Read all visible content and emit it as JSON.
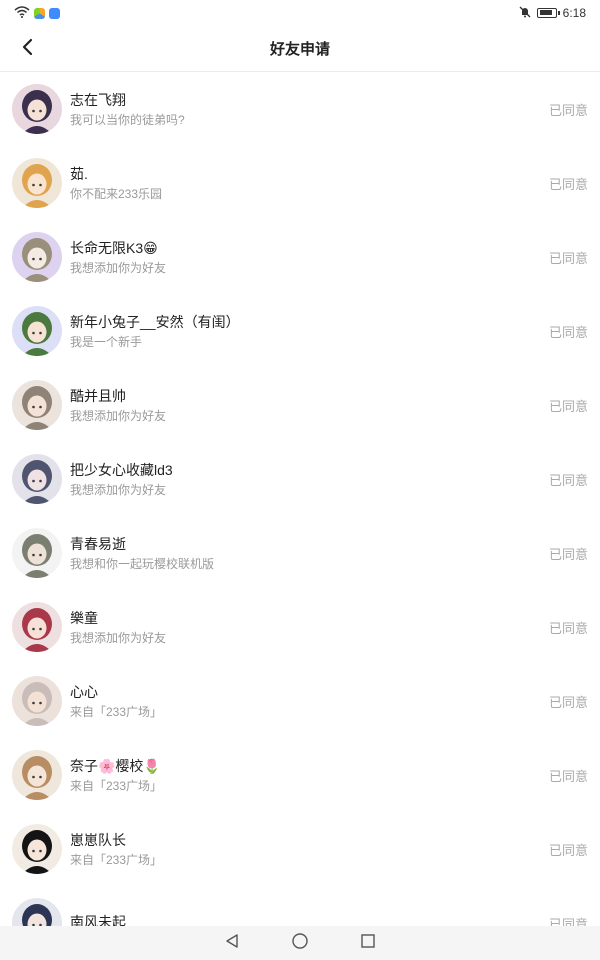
{
  "status_bar": {
    "time": "6:18"
  },
  "header": {
    "title": "好友申请"
  },
  "requests": [
    {
      "name": "志在飞翔",
      "message": "我可以当你的徒弟吗?",
      "status": "已同意",
      "avatar_colors": [
        "#e9d7df",
        "#3a2f4d",
        "#f6e1d6"
      ]
    },
    {
      "name": "茹.",
      "message": "你不配来233乐园",
      "status": "已同意",
      "avatar_colors": [
        "#efe6d8",
        "#e0a44e",
        "#f9e4cf"
      ]
    },
    {
      "name": "长命无限K3😁",
      "message": "我想添加你为好友",
      "status": "已同意",
      "avatar_colors": [
        "#ddd3f0",
        "#9a8f7a",
        "#f3ece2"
      ]
    },
    {
      "name": "新年小兔子__安然（有闺）",
      "message": "我是一个新手",
      "status": "已同意",
      "avatar_colors": [
        "#dcdff5",
        "#4a7a3e",
        "#f6e3d3"
      ]
    },
    {
      "name": "酷并且帅",
      "message": "我想添加你为好友",
      "status": "已同意",
      "avatar_colors": [
        "#ece3dc",
        "#8f8378",
        "#f4e2d6"
      ]
    },
    {
      "name": "把少女心收藏ld3",
      "message": "我想添加你为好友",
      "status": "已同意",
      "avatar_colors": [
        "#e3e2ea",
        "#4f556e",
        "#efe1e4"
      ]
    },
    {
      "name": "青春易逝",
      "message": "我想和你一起玩樱校联机版",
      "status": "已同意",
      "avatar_colors": [
        "#f3f3f3",
        "#7a7f70",
        "#eee2d8"
      ]
    },
    {
      "name": "樂童",
      "message": "我想添加你为好友",
      "status": "已同意",
      "avatar_colors": [
        "#eee0e0",
        "#a9394a",
        "#f6e0d7"
      ]
    },
    {
      "name": "心心",
      "message": "来自「233广场」",
      "status": "已同意",
      "avatar_colors": [
        "#ede1db",
        "#c9bdb9",
        "#f4e1d6"
      ]
    },
    {
      "name": "奈子🌸樱校🌷",
      "message": "来自「233广场」",
      "status": "已同意",
      "avatar_colors": [
        "#efe6dc",
        "#b98d63",
        "#f5e4d8"
      ]
    },
    {
      "name": "崽崽队长",
      "message": "来自「233广场」",
      "status": "已同意",
      "avatar_colors": [
        "#f1ebe4",
        "#141416",
        "#f6e6da"
      ]
    },
    {
      "name": "南风未起",
      "message": "",
      "status": "已同意",
      "avatar_colors": [
        "#e4e6ee",
        "#2c3553",
        "#f2e5e0"
      ]
    }
  ]
}
